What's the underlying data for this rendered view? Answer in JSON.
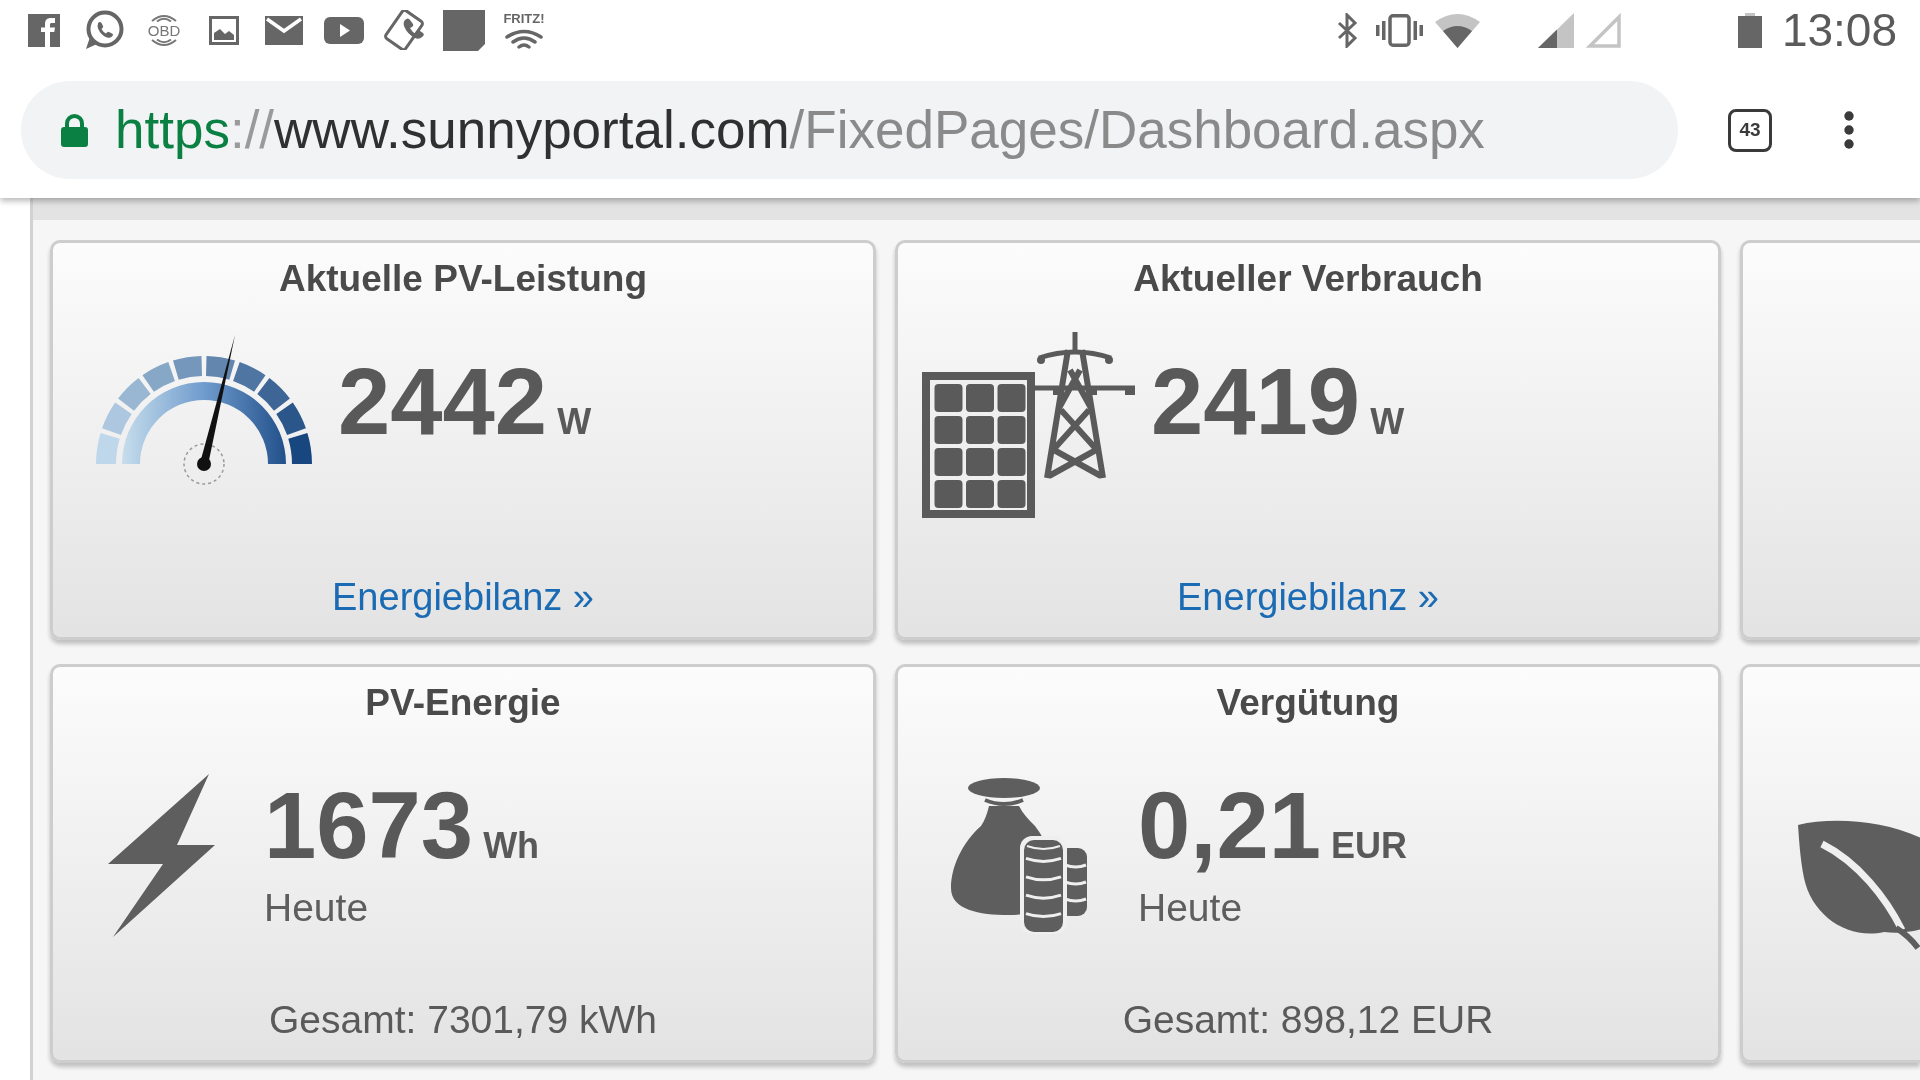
{
  "status_bar": {
    "notification_icons": [
      {
        "kind": "facebook"
      },
      {
        "kind": "whatsapp"
      },
      {
        "kind": "obd",
        "label": "OBD"
      },
      {
        "kind": "gallery"
      },
      {
        "kind": "mail"
      },
      {
        "kind": "youtube"
      },
      {
        "kind": "calls"
      },
      {
        "kind": "app"
      },
      {
        "kind": "fritz",
        "label": "FRITZ!"
      }
    ],
    "time": "13:08"
  },
  "browser": {
    "url": {
      "scheme": "https",
      "separator": "://",
      "host": "www.sunnyportal.com",
      "path": "/FixedPages/Dashboard.aspx"
    },
    "tab_count": "43"
  },
  "tiles": [
    {
      "kind": "pv_power",
      "title": "Aktuelle PV-Leistung",
      "value": "2442",
      "unit": "W",
      "link": "Energiebilanz »"
    },
    {
      "kind": "consumption",
      "title": "Aktueller Verbrauch",
      "value": "2419",
      "unit": "W",
      "link": "Energiebilanz »"
    },
    {
      "kind": "blank"
    },
    {
      "kind": "pv_energy",
      "title": "PV-Energie",
      "value": "1673",
      "unit": "Wh",
      "caption": "Heute",
      "footer": "Gesamt: 7301,79 kWh"
    },
    {
      "kind": "compensation",
      "title": "Vergütung",
      "value": "0,21",
      "unit": "EUR",
      "caption": "Heute",
      "footer": "Gesamt: 898,12 EUR"
    },
    {
      "kind": "co2"
    }
  ]
}
